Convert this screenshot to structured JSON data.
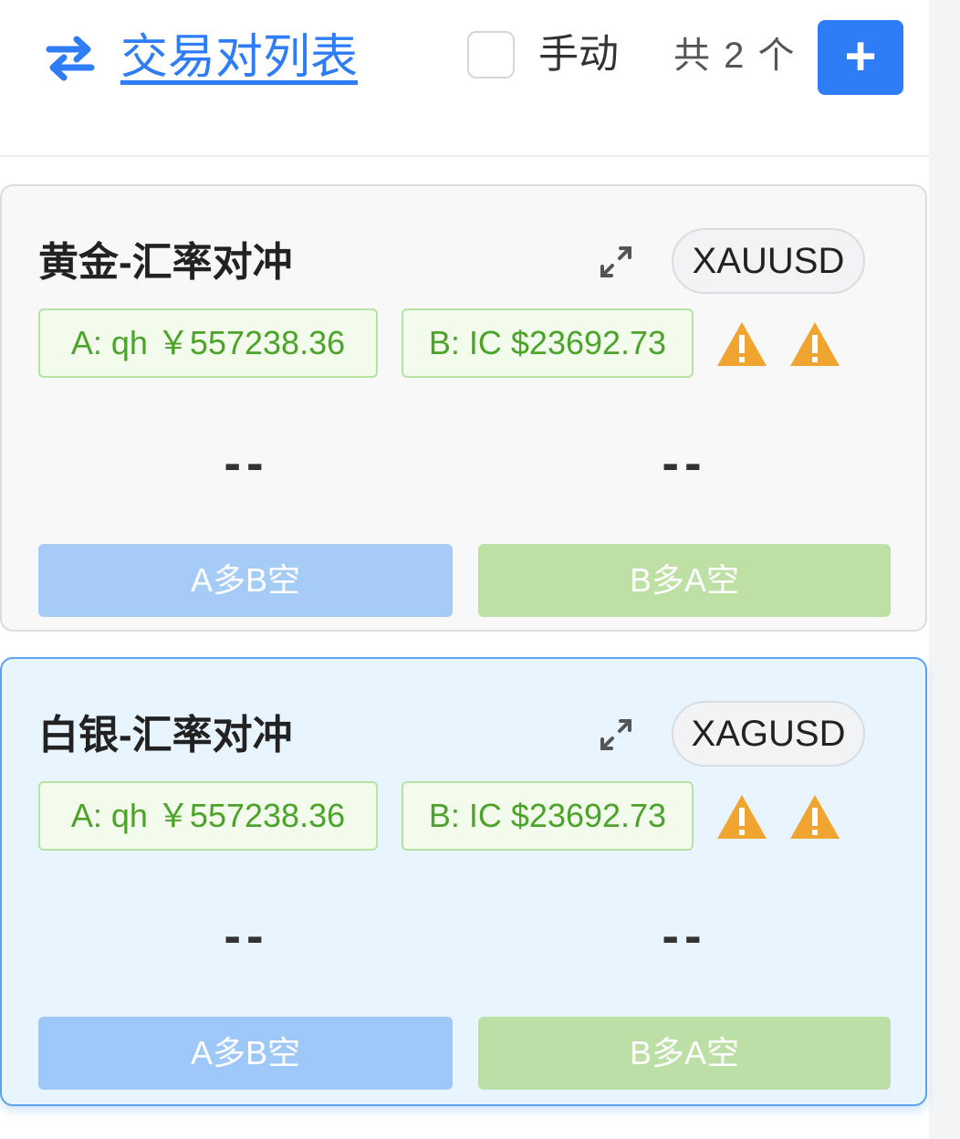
{
  "header": {
    "icon": "swap-arrows-icon",
    "title": "交易对列表",
    "manual_label": "手动",
    "manual_checked": false,
    "count_text": "共 2 个",
    "add_label": "+"
  },
  "colors": {
    "accent": "#2f7df6",
    "tag_green": "#4ca32a",
    "warning": "#f0a531",
    "btn_blue": "#a5cbf7",
    "btn_green": "#bfe0a5"
  },
  "pairs": [
    {
      "name": "黄金-汇率对冲",
      "symbol": "XAUUSD",
      "account_a": "A: qh ￥557238.36",
      "account_b": "B: IC $23692.73",
      "value_left": "--",
      "value_right": "--",
      "btn_a_long_b_short": "A多B空",
      "btn_b_long_a_short": "B多A空"
    },
    {
      "name": "白银-汇率对冲",
      "symbol": "XAGUSD",
      "account_a": "A: qh ￥557238.36",
      "account_b": "B: IC $23692.73",
      "value_left": "--",
      "value_right": "--",
      "btn_a_long_b_short": "A多B空",
      "btn_b_long_a_short": "B多A空"
    }
  ]
}
